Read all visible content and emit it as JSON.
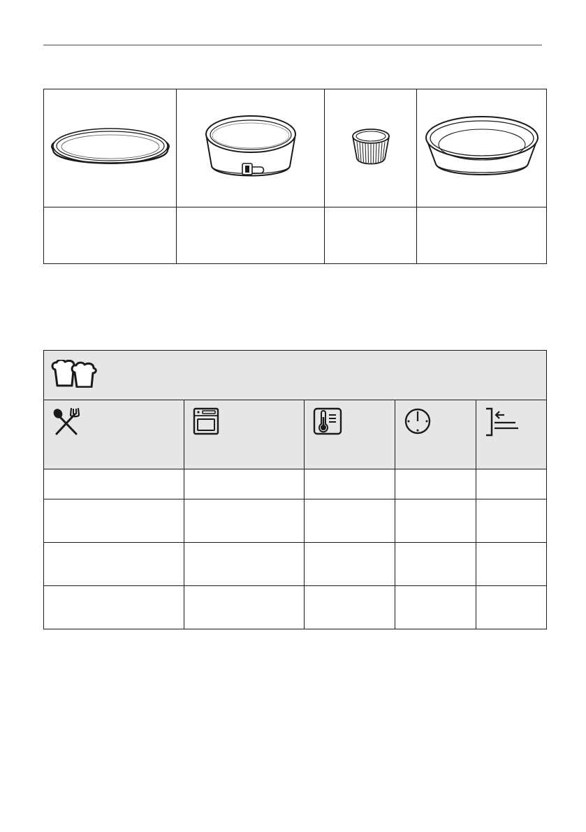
{
  "bakeware": {
    "items": [
      {
        "icon": "flan-base-tin-icon",
        "label": ""
      },
      {
        "icon": "springform-tin-icon",
        "label": ""
      },
      {
        "icon": "ramekin-icon",
        "label": ""
      },
      {
        "icon": "cake-pan-icon",
        "label": ""
      }
    ]
  },
  "settings_table": {
    "header_icon": "bread-loaves-icon",
    "column_icons": [
      "cutlery-icon",
      "oven-function-icon",
      "temperature-icon",
      "time-icon",
      "shelf-position-icon"
    ],
    "rows": [
      [
        "",
        "",
        "",
        "",
        ""
      ],
      [
        "",
        "",
        "",
        "",
        ""
      ],
      [
        "",
        "",
        "",
        "",
        ""
      ],
      [
        "",
        "",
        "",
        "",
        ""
      ]
    ]
  },
  "colors": {
    "line": "#1a1a1a",
    "header_fill": "#e6e6e6",
    "rule": "#4a4a4a"
  }
}
